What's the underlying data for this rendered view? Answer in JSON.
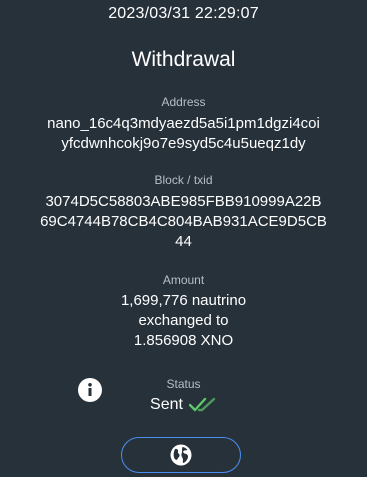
{
  "timestamp": "2023/03/31 22:29:07",
  "title": "Withdrawal",
  "address": {
    "label": "Address",
    "line1": "nano_16c4q3mdyaezd5a5i1pm1dgzi4coi",
    "line2": "yfcdwnhcokj9o7e9syd5c4u5ueqz1dy"
  },
  "block": {
    "label": "Block / txid",
    "line1": "3074D5C58803ABE985FBB910999A22B",
    "line2": "69C4744B78CB4C804BAB931ACE9D5CB",
    "line3": "44"
  },
  "amount": {
    "label": "Amount",
    "line1": "1,699,776 nautrino",
    "line2": "exchanged to",
    "line3": "1.856908 XNO"
  },
  "status": {
    "label": "Status",
    "value": "Sent",
    "icon": "double-check-icon",
    "icon_color": "#5cc96b"
  },
  "icons": {
    "info": "info-icon",
    "web": "globe-icon"
  },
  "colors": {
    "background": "#27313a",
    "accent": "#4a8ff0"
  }
}
